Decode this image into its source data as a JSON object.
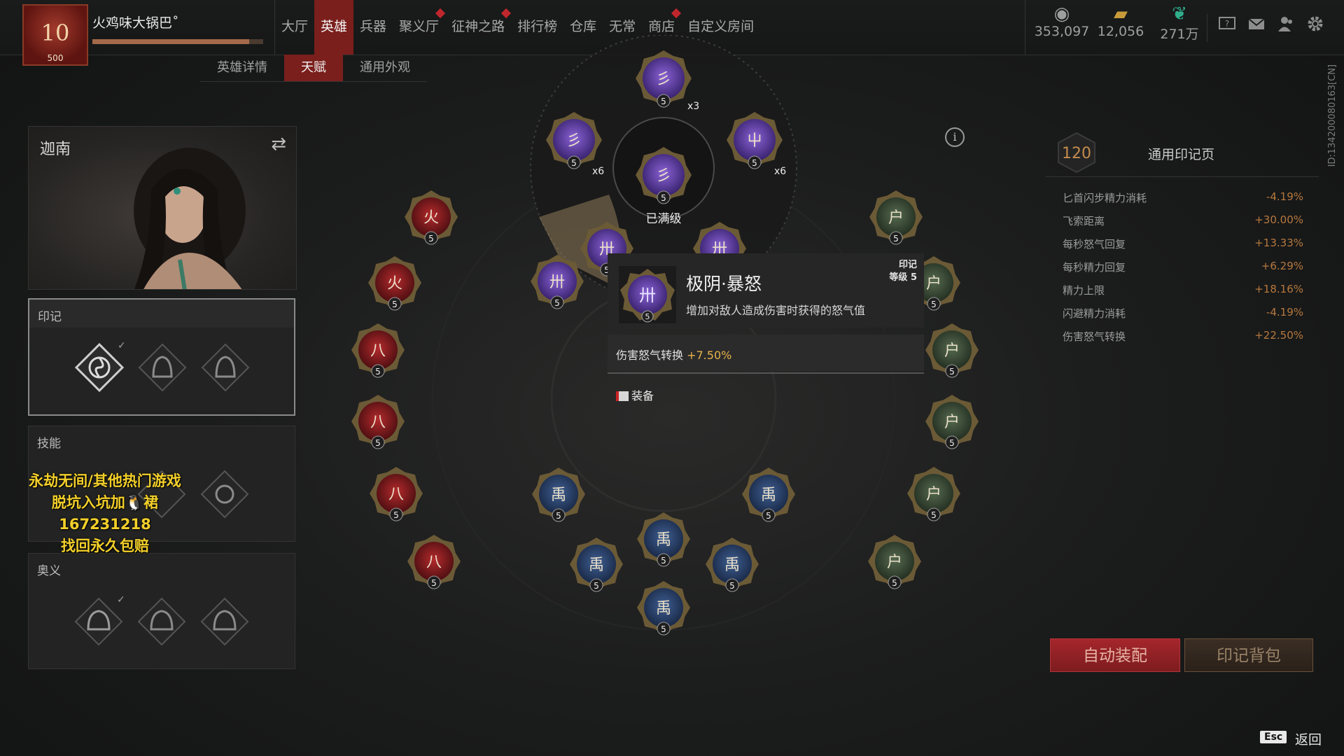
{
  "player": {
    "level": "10",
    "sublevel": "500",
    "name": "火鸡味大锅巴˚",
    "progress": 0.92
  },
  "nav": {
    "items": [
      {
        "label": "大厅",
        "active": false,
        "dot": false
      },
      {
        "label": "英雄",
        "active": true,
        "dot": false
      },
      {
        "label": "兵器",
        "active": false,
        "dot": false
      },
      {
        "label": "聚义厅",
        "active": false,
        "dot": true
      },
      {
        "label": "征神之路",
        "active": false,
        "dot": true
      },
      {
        "label": "排行榜",
        "active": false,
        "dot": false
      },
      {
        "label": "仓库",
        "active": false,
        "dot": false
      },
      {
        "label": "无常",
        "active": false,
        "dot": false
      },
      {
        "label": "商店",
        "active": false,
        "dot": true
      },
      {
        "label": "自定义房间",
        "active": false,
        "dot": false
      }
    ]
  },
  "currencies": [
    {
      "icon": "coin-icon",
      "value": "353,097",
      "color": "#9e9e9e"
    },
    {
      "icon": "gold-bar-icon",
      "value": "12,056",
      "color": "#c79a3a"
    },
    {
      "icon": "feather-icon",
      "value": "271万",
      "color": "#2fae8c"
    }
  ],
  "subtabs": [
    {
      "label": "英雄详情",
      "active": false
    },
    {
      "label": "天赋",
      "active": true
    },
    {
      "label": "通用外观",
      "active": false
    }
  ],
  "hero": {
    "name": "迦南"
  },
  "panels": {
    "seal": {
      "title": "印记"
    },
    "skill": {
      "title": "技能"
    },
    "mystery": {
      "title": "奥义"
    }
  },
  "promo": {
    "line1": "永劫无间/其他热门游戏",
    "line2": "脱坑入坑加🐧裙167231218",
    "line3": "找回永久包赔"
  },
  "center": {
    "maxed_label": "已满级",
    "node_level": "5",
    "multipliers": {
      "top": "x3",
      "left": "x6",
      "right": "x6"
    }
  },
  "tooltip": {
    "name": "极阴·暴怒",
    "desc": "增加对敌人造成伤害时获得的怒气值",
    "tag_line1": "印记",
    "tag_line2": "等级 5",
    "stat_label": "伤害怒气转换 ",
    "stat_value": "+7.50%",
    "equip": "装备"
  },
  "right_panel": {
    "points": "120",
    "title": "通用印记页",
    "stats": [
      {
        "name": "匕首闪步精力消耗",
        "value": "-4.19%"
      },
      {
        "name": "飞索距离",
        "value": "+30.00%"
      },
      {
        "name": "每秒怒气回复",
        "value": "+13.33%"
      },
      {
        "name": "每秒精力回复",
        "value": "+6.29%"
      },
      {
        "name": "精力上限",
        "value": "+18.16%"
      },
      {
        "name": "闪避精力消耗",
        "value": "-4.19%"
      },
      {
        "name": "伤害怒气转换",
        "value": "+22.50%"
      }
    ]
  },
  "buttons": {
    "auto_equip": "自动装配",
    "seal_bag": "印记背包",
    "esc_key": "Esc",
    "back": "返回"
  },
  "side_id": "ID:134200080163[CN]",
  "colors": {
    "accent": "#7a1f1c",
    "red_node": "#8c1d1f",
    "green_node": "#3b4a38",
    "blue_node": "#283f66",
    "purple_node": "#5a3aa0"
  }
}
